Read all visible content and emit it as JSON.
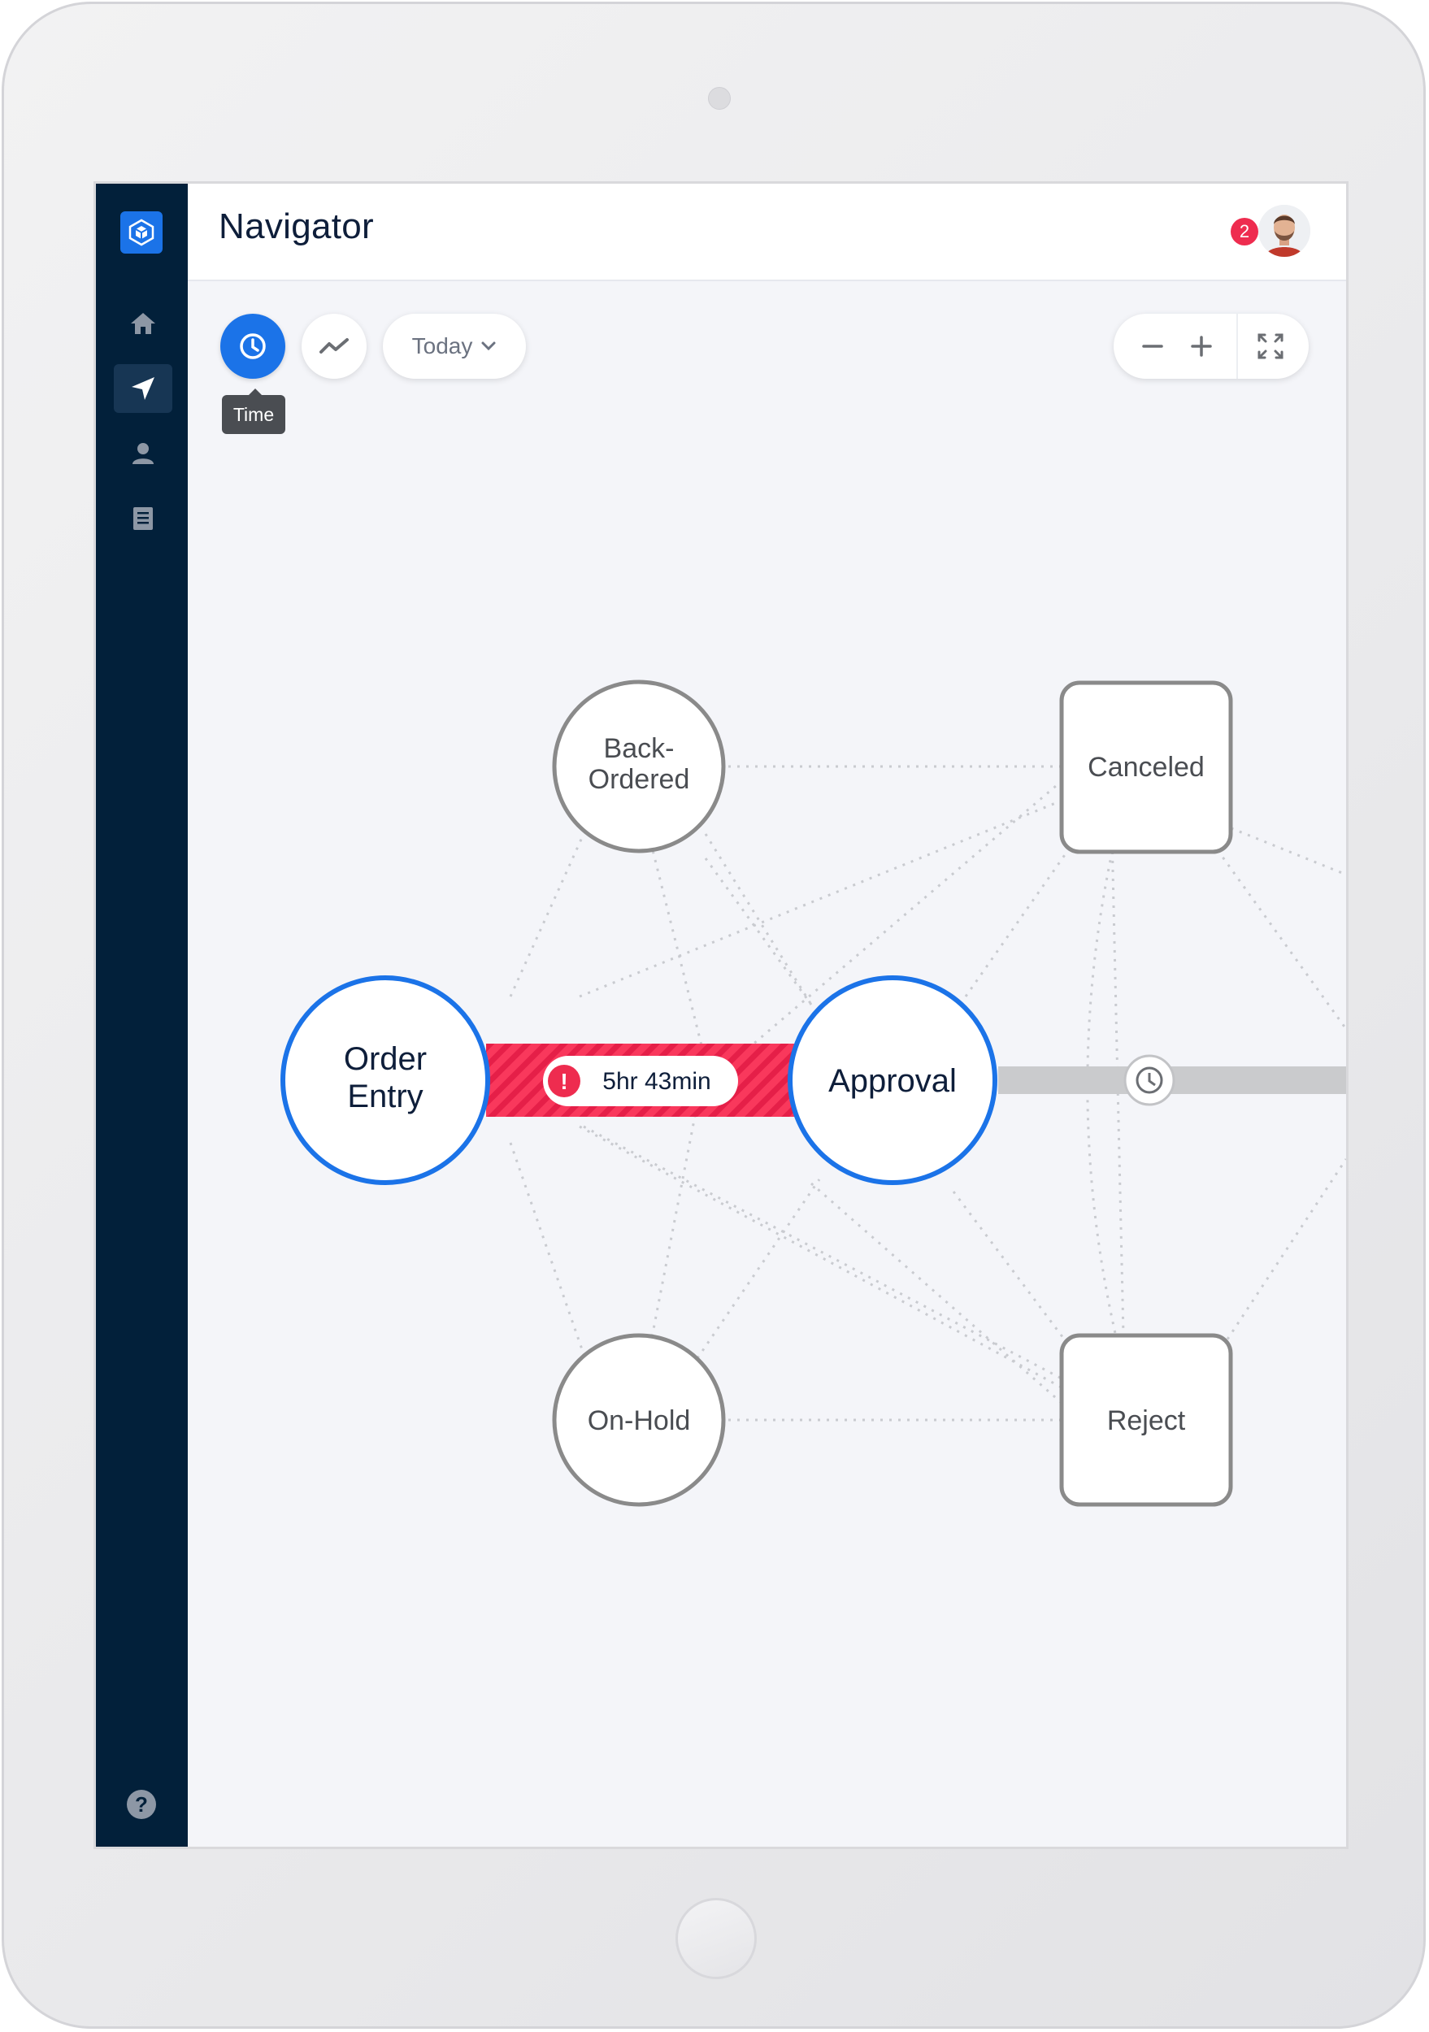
{
  "header": {
    "title": "Navigator",
    "notification_count": "2"
  },
  "toolbar": {
    "time_tooltip": "Time",
    "date_range": "Today"
  },
  "nodes": {
    "back_ordered": [
      "Back-",
      "Ordered"
    ],
    "canceled": "Canceled",
    "order_entry": [
      "Order",
      "Entry"
    ],
    "approval": "Approval",
    "on_hold": "On-Hold",
    "reject": "Reject"
  },
  "edge_alert": {
    "duration": "5hr 43min"
  },
  "colors": {
    "sidebar": "#02203a",
    "accent_blue": "#1b73e8",
    "alert_red": "#ee2c4f",
    "node_gray": "#8a8a8a",
    "canvas": "#f4f5f9"
  },
  "icons": {
    "sidebar": [
      "home-icon",
      "navigation-icon",
      "user-icon",
      "document-icon"
    ],
    "help": "help-icon"
  }
}
